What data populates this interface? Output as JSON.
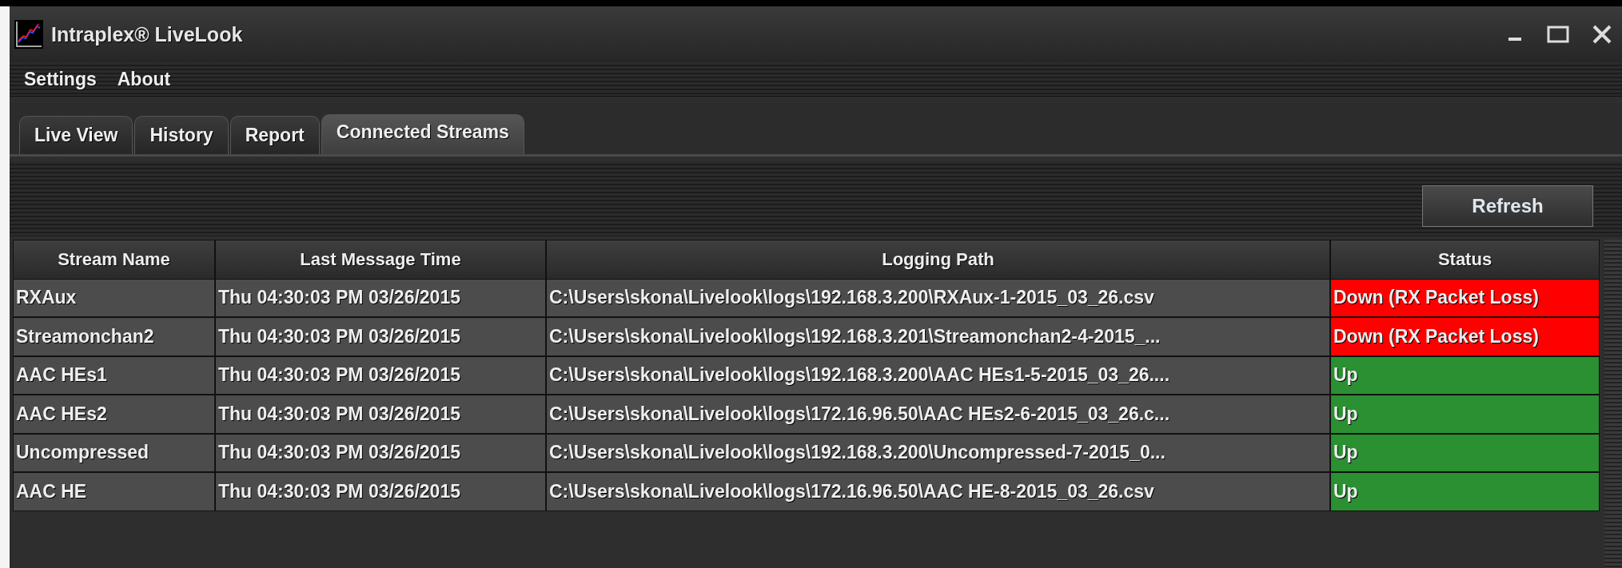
{
  "window": {
    "title": "Intraplex® LiveLook"
  },
  "menu": [
    "Settings",
    "About"
  ],
  "tabs": [
    {
      "label": "Live View",
      "selected": false
    },
    {
      "label": "History",
      "selected": false
    },
    {
      "label": "Report",
      "selected": false
    },
    {
      "label": "Connected Streams",
      "selected": true
    }
  ],
  "refresh_button": "Refresh",
  "table": {
    "columns": [
      "Stream Name",
      "Last Message Time",
      "Logging Path",
      "Status"
    ],
    "rows": [
      {
        "name": "RXAux",
        "time": "Thu 04:30:03 PM 03/26/2015",
        "path": "C:\\Users\\skona\\Livelook\\logs\\192.168.3.200\\RXAux-1-2015_03_26.csv",
        "status": "Down (RX Packet Loss)",
        "color": "#ff0000"
      },
      {
        "name": "Streamonchan2",
        "time": "Thu 04:30:03 PM 03/26/2015",
        "path": "C:\\Users\\skona\\Livelook\\logs\\192.168.3.201\\Streamonchan2-4-2015_...",
        "status": "Down (RX Packet Loss)",
        "color": "#ff0000"
      },
      {
        "name": "AAC HEs1",
        "time": "Thu 04:30:03 PM 03/26/2015",
        "path": "C:\\Users\\skona\\Livelook\\logs\\192.168.3.200\\AAC HEs1-5-2015_03_26....",
        "status": "Up",
        "color": "#2a9032"
      },
      {
        "name": "AAC HEs2",
        "time": "Thu 04:30:03 PM 03/26/2015",
        "path": "C:\\Users\\skona\\Livelook\\logs\\172.16.96.50\\AAC HEs2-6-2015_03_26.c...",
        "status": "Up",
        "color": "#2a9032"
      },
      {
        "name": "Uncompressed",
        "time": "Thu 04:30:03 PM 03/26/2015",
        "path": "C:\\Users\\skona\\Livelook\\logs\\192.168.3.200\\Uncompressed-7-2015_0...",
        "status": "Up",
        "color": "#2a9032"
      },
      {
        "name": "AAC HE",
        "time": "Thu 04:30:03 PM 03/26/2015",
        "path": "C:\\Users\\skona\\Livelook\\logs\\172.16.96.50\\AAC HE-8-2015_03_26.csv",
        "status": "Up",
        "color": "#2a9032"
      }
    ]
  }
}
